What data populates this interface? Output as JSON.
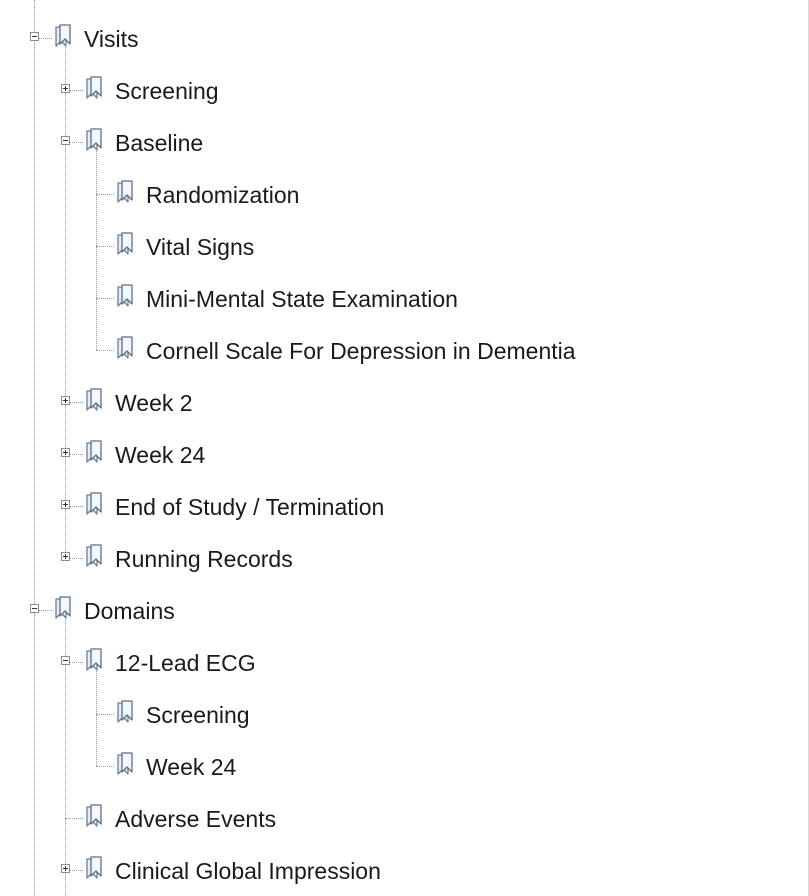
{
  "tree": {
    "items": [
      {
        "label": "Visits",
        "level": 0,
        "expander": "minus",
        "parent": null
      },
      {
        "label": "Screening",
        "level": 1,
        "expander": "plus",
        "parent": 0
      },
      {
        "label": "Baseline",
        "level": 1,
        "expander": "minus",
        "parent": 0
      },
      {
        "label": "Randomization",
        "level": 2,
        "expander": "none",
        "parent": 2
      },
      {
        "label": "Vital Signs",
        "level": 2,
        "expander": "none",
        "parent": 2
      },
      {
        "label": "Mini-Mental State Examination",
        "level": 2,
        "expander": "none",
        "parent": 2
      },
      {
        "label": "Cornell Scale For Depression in Dementia",
        "level": 2,
        "expander": "none",
        "parent": 2
      },
      {
        "label": "Week 2",
        "level": 1,
        "expander": "plus",
        "parent": 0
      },
      {
        "label": "Week 24",
        "level": 1,
        "expander": "plus",
        "parent": 0
      },
      {
        "label": "End of Study / Termination",
        "level": 1,
        "expander": "plus",
        "parent": 0
      },
      {
        "label": "Running Records",
        "level": 1,
        "expander": "plus",
        "parent": 0
      },
      {
        "label": "Domains",
        "level": 0,
        "expander": "minus",
        "parent": null
      },
      {
        "label": "12-Lead ECG",
        "level": 1,
        "expander": "minus",
        "parent": 11
      },
      {
        "label": "Screening",
        "level": 2,
        "expander": "none",
        "parent": 12
      },
      {
        "label": "Week 24",
        "level": 2,
        "expander": "none",
        "parent": 12
      },
      {
        "label": "Adverse Events",
        "level": 1,
        "expander": "none",
        "parent": 11
      },
      {
        "label": "Clinical Global Impression",
        "level": 1,
        "expander": "plus",
        "parent": 11
      }
    ]
  }
}
